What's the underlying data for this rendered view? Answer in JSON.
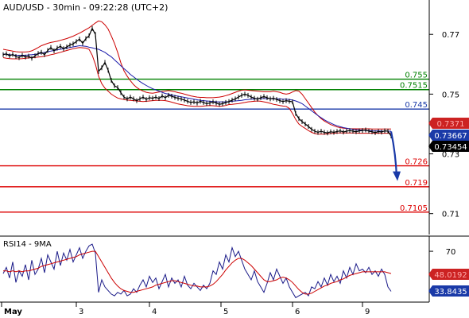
{
  "header": {
    "title": "AUD/USD - 30min - 09:22:28 (UTC+2)"
  },
  "colors": {
    "price": "#000000",
    "bollinger": "#cc0000",
    "moving_average": "#1a1aaa",
    "resistance": "#008000",
    "pivot": "#1a3aa8",
    "support": "#dd0000",
    "forecast_arrow": "#1a3aa8",
    "rsi_line": "#1a1a88",
    "rsi_ma": "#cc0000",
    "axis_text": "#000000"
  },
  "chart_data": [
    {
      "type": "line",
      "title": "AUD/USD - 30min - 09:22:28 (UTC+2)",
      "x_ticks": [
        "May",
        "3",
        "4",
        "5",
        "6",
        "9"
      ],
      "y_ticks": [
        "0.77",
        "0.75",
        "0.73",
        "0.71"
      ],
      "ylim": [
        0.703,
        0.7815
      ],
      "grid": false,
      "x": [
        0,
        4,
        8,
        12,
        16,
        20,
        24,
        28,
        32,
        36,
        40,
        44,
        48,
        52,
        56,
        60,
        64,
        68,
        72,
        76,
        80,
        84,
        88,
        92,
        96,
        100,
        104,
        108,
        112,
        116,
        120,
        124,
        128,
        132,
        136,
        140,
        144,
        148,
        152,
        156,
        160,
        164,
        168,
        172,
        176,
        180,
        184,
        188,
        192,
        196,
        200,
        204,
        208,
        212,
        216,
        220,
        224,
        228,
        232,
        236,
        240,
        244,
        248,
        252,
        256,
        260,
        264,
        268,
        272,
        276,
        280,
        284,
        288,
        292,
        296,
        300,
        304,
        308,
        312,
        316,
        320,
        324,
        328,
        332,
        336,
        340,
        344,
        348,
        352,
        356,
        360,
        364,
        368,
        372,
        376,
        380,
        384,
        388,
        392,
        396,
        400,
        404,
        408,
        412,
        416,
        420,
        424,
        428,
        432,
        436,
        440,
        444,
        448,
        452,
        456,
        460,
        464,
        468,
        472,
        476,
        480,
        484,
        488
      ],
      "series": [
        {
          "key": "price",
          "values": [
            0.7632,
            0.7635,
            0.7628,
            0.7633,
            0.7626,
            0.7622,
            0.763,
            0.7624,
            0.7627,
            0.762,
            0.7628,
            0.7636,
            0.764,
            0.7632,
            0.7646,
            0.7656,
            0.7645,
            0.7654,
            0.766,
            0.7652,
            0.7658,
            0.7664,
            0.7668,
            0.7676,
            0.7684,
            0.767,
            0.7686,
            0.7695,
            0.772,
            0.77,
            0.7576,
            0.7588,
            0.7606,
            0.758,
            0.7546,
            0.7528,
            0.7522,
            0.7505,
            0.749,
            0.7484,
            0.749,
            0.7484,
            0.7478,
            0.7484,
            0.749,
            0.7482,
            0.7488,
            0.7486,
            0.749,
            0.7485,
            0.7494,
            0.7488,
            0.7496,
            0.7493,
            0.7489,
            0.7486,
            0.7484,
            0.748,
            0.7476,
            0.7472,
            0.7474,
            0.747,
            0.7476,
            0.7472,
            0.7468,
            0.747,
            0.7474,
            0.747,
            0.7466,
            0.7468,
            0.7472,
            0.7475,
            0.748,
            0.7484,
            0.749,
            0.7496,
            0.75,
            0.7496,
            0.749,
            0.7486,
            0.7483,
            0.7488,
            0.7492,
            0.7488,
            0.7484,
            0.7486,
            0.7482,
            0.7478,
            0.7475,
            0.7478,
            0.7476,
            0.7474,
            0.7435,
            0.7418,
            0.7408,
            0.74,
            0.7392,
            0.7382,
            0.7376,
            0.7372,
            0.7376,
            0.7372,
            0.737,
            0.7374,
            0.7372,
            0.7375,
            0.7377,
            0.7373,
            0.7376,
            0.7378,
            0.7376,
            0.7374,
            0.7377,
            0.7378,
            0.738,
            0.7376,
            0.7374,
            0.7371,
            0.7375,
            0.7373,
            0.7377,
            0.7376,
            0.736
          ]
        },
        {
          "key": "ma",
          "values": [
            0.7634,
            0.7633,
            0.7632,
            0.7631,
            0.763,
            0.763,
            0.763,
            0.763,
            0.7631,
            0.7632,
            0.7633,
            0.7635,
            0.7637,
            0.764,
            0.7642,
            0.7644,
            0.7646,
            0.7648,
            0.765,
            0.7652,
            0.7654,
            0.7656,
            0.7658,
            0.766,
            0.7662,
            0.7661,
            0.766,
            0.7657,
            0.7655,
            0.7652,
            0.765,
            0.7645,
            0.764,
            0.7632,
            0.7625,
            0.7615,
            0.7605,
            0.7595,
            0.7585,
            0.7576,
            0.7566,
            0.7558,
            0.755,
            0.7542,
            0.7535,
            0.7529,
            0.7523,
            0.7518,
            0.7514,
            0.751,
            0.7506,
            0.7502,
            0.75,
            0.7497,
            0.7495,
            0.7493,
            0.7491,
            0.7489,
            0.7487,
            0.7485,
            0.7483,
            0.7481,
            0.7479,
            0.7478,
            0.7477,
            0.7476,
            0.7475,
            0.7474,
            0.7474,
            0.7474,
            0.7474,
            0.7475,
            0.7476,
            0.7477,
            0.7478,
            0.7479,
            0.7481,
            0.7482,
            0.7483,
            0.7484,
            0.7485,
            0.7485,
            0.7485,
            0.7485,
            0.7485,
            0.7484,
            0.7484,
            0.7484,
            0.7483,
            0.7483,
            0.7482,
            0.748,
            0.7477,
            0.7473,
            0.7468,
            0.746,
            0.7452,
            0.7444,
            0.7436,
            0.7428,
            0.7421,
            0.7414,
            0.7408,
            0.7403,
            0.7398,
            0.7394,
            0.7391,
            0.7388,
            0.7386,
            0.7384,
            0.7382,
            0.7381,
            0.738,
            0.7379,
            0.7378,
            0.7378,
            0.7377,
            0.7377,
            0.7377,
            0.7376,
            0.7376,
            0.7376,
            0.7376
          ]
        },
        {
          "key": "bb_upper",
          "values": [
            0.765,
            0.7648,
            0.7646,
            0.7644,
            0.7642,
            0.7641,
            0.7641,
            0.7641,
            0.7642,
            0.7645,
            0.765,
            0.7656,
            0.7662,
            0.7666,
            0.767,
            0.7673,
            0.7675,
            0.7677,
            0.768,
            0.7683,
            0.7686,
            0.769,
            0.7694,
            0.7699,
            0.7704,
            0.771,
            0.7716,
            0.7722,
            0.773,
            0.7738,
            0.7745,
            0.7742,
            0.7732,
            0.7718,
            0.7695,
            0.767,
            0.764,
            0.7605,
            0.7578,
            0.756,
            0.7545,
            0.7532,
            0.7522,
            0.7515,
            0.751,
            0.7506,
            0.7504,
            0.7503,
            0.7505,
            0.7507,
            0.7509,
            0.751,
            0.7512,
            0.751,
            0.7508,
            0.7505,
            0.7503,
            0.75,
            0.7497,
            0.7494,
            0.7492,
            0.749,
            0.7489,
            0.7489,
            0.7488,
            0.7488,
            0.7488,
            0.7489,
            0.749,
            0.7492,
            0.7495,
            0.7498,
            0.7502,
            0.7506,
            0.751,
            0.7513,
            0.7514,
            0.7513,
            0.7512,
            0.7511,
            0.751,
            0.7509,
            0.7508,
            0.7508,
            0.7508,
            0.751,
            0.7508,
            0.7506,
            0.7502,
            0.75,
            0.7502,
            0.7507,
            0.7512,
            0.751,
            0.75,
            0.7485,
            0.747,
            0.7455,
            0.744,
            0.7428,
            0.7418,
            0.741,
            0.7404,
            0.7398,
            0.7394,
            0.739,
            0.7388,
            0.7386,
            0.7385,
            0.7384,
            0.7384,
            0.7384,
            0.7384,
            0.7384,
            0.7384,
            0.7384,
            0.7383,
            0.7383,
            0.7383,
            0.7383,
            0.7383,
            0.7383,
            0.7383
          ]
        },
        {
          "key": "bb_lower",
          "values": [
            0.7622,
            0.762,
            0.7619,
            0.7618,
            0.7618,
            0.7618,
            0.7619,
            0.762,
            0.7621,
            0.7622,
            0.7623,
            0.7624,
            0.7625,
            0.7627,
            0.7629,
            0.7632,
            0.7634,
            0.7637,
            0.764,
            0.7643,
            0.7646,
            0.7649,
            0.7652,
            0.7654,
            0.7656,
            0.7655,
            0.7654,
            0.765,
            0.763,
            0.76,
            0.756,
            0.7535,
            0.752,
            0.751,
            0.75,
            0.7493,
            0.7487,
            0.7484,
            0.7482,
            0.748,
            0.7479,
            0.7478,
            0.7477,
            0.7476,
            0.7475,
            0.7476,
            0.7477,
            0.7478,
            0.7479,
            0.7479,
            0.7479,
            0.7478,
            0.7476,
            0.7473,
            0.747,
            0.7467,
            0.7465,
            0.7463,
            0.7461,
            0.746,
            0.7459,
            0.7459,
            0.7459,
            0.746,
            0.7461,
            0.7462,
            0.7461,
            0.746,
            0.7459,
            0.746,
            0.7462,
            0.7465,
            0.7466,
            0.7467,
            0.7468,
            0.747,
            0.7472,
            0.7474,
            0.7475,
            0.7476,
            0.7477,
            0.7476,
            0.7474,
            0.7472,
            0.7469,
            0.7466,
            0.7464,
            0.7462,
            0.746,
            0.7459,
            0.7452,
            0.7435,
            0.7415,
            0.74,
            0.7392,
            0.7385,
            0.7378,
            0.7372,
            0.7368,
            0.7366,
            0.7366,
            0.7366,
            0.7367,
            0.7368,
            0.7369,
            0.737,
            0.737,
            0.737,
            0.737,
            0.737,
            0.737,
            0.737,
            0.7369,
            0.7369,
            0.7369,
            0.7369,
            0.7369,
            0.7369,
            0.7369,
            0.7369,
            0.7369,
            0.7369,
            0.7369
          ]
        }
      ],
      "levels": [
        {
          "value": 0.755,
          "label": "0.755",
          "kind": "resistance"
        },
        {
          "value": 0.7515,
          "label": "0.7515",
          "kind": "resistance"
        },
        {
          "value": 0.745,
          "label": "0.745",
          "kind": "pivot"
        },
        {
          "value": 0.726,
          "label": "0.726",
          "kind": "support"
        },
        {
          "value": 0.719,
          "label": "0.719",
          "kind": "support"
        },
        {
          "value": 0.7105,
          "label": "0.7105",
          "kind": "support"
        }
      ],
      "price_tags": [
        {
          "value": 0.7371,
          "label": "0.7371",
          "bg": "#cc2222",
          "fg": "#ffaaaa"
        },
        {
          "value": 0.73667,
          "label": "0.73667",
          "bg": "#1a3aa8",
          "fg": "#ffffff"
        },
        {
          "value": 0.73454,
          "label": "0.73454",
          "bg": "#000000",
          "fg": "#ffffff"
        }
      ],
      "forecast_arrow": {
        "from": {
          "x": 488,
          "y": 0.7375
        },
        "to": {
          "x": 495,
          "y": 0.722
        }
      }
    },
    {
      "type": "line",
      "title": "RSI14 - 9MA",
      "y_ticks": [
        "70"
      ],
      "ylim": [
        13,
        87
      ],
      "x": [
        0,
        4,
        8,
        12,
        16,
        20,
        24,
        28,
        32,
        36,
        40,
        44,
        48,
        52,
        56,
        60,
        64,
        68,
        72,
        76,
        80,
        84,
        88,
        92,
        96,
        100,
        104,
        108,
        112,
        116,
        120,
        124,
        128,
        132,
        136,
        140,
        144,
        148,
        152,
        156,
        160,
        164,
        168,
        172,
        176,
        180,
        184,
        188,
        192,
        196,
        200,
        204,
        208,
        212,
        216,
        220,
        224,
        228,
        232,
        236,
        240,
        244,
        248,
        252,
        256,
        260,
        264,
        268,
        272,
        276,
        280,
        284,
        288,
        292,
        296,
        300,
        304,
        308,
        312,
        316,
        320,
        324,
        328,
        332,
        336,
        340,
        344,
        348,
        352,
        356,
        360,
        364,
        368,
        372,
        376,
        380,
        384,
        388,
        392,
        396,
        400,
        404,
        408,
        412,
        416,
        420,
        424,
        428,
        432,
        436,
        440,
        444,
        448,
        452,
        456,
        460,
        464,
        468,
        472,
        476,
        480,
        484,
        488
      ],
      "series": [
        {
          "key": "rsi",
          "values": [
            45,
            52,
            40,
            58,
            35,
            48,
            42,
            55,
            38,
            60,
            44,
            50,
            62,
            46,
            66,
            58,
            50,
            70,
            54,
            68,
            60,
            72,
            58,
            66,
            74,
            62,
            70,
            76,
            78,
            68,
            24,
            38,
            30,
            26,
            22,
            20,
            24,
            22,
            26,
            20,
            22,
            28,
            24,
            32,
            38,
            30,
            42,
            35,
            40,
            28,
            36,
            44,
            30,
            40,
            34,
            38,
            30,
            42,
            32,
            28,
            34,
            30,
            26,
            32,
            28,
            34,
            48,
            44,
            58,
            50,
            66,
            58,
            74,
            64,
            70,
            60,
            50,
            44,
            38,
            48,
            36,
            30,
            24,
            34,
            46,
            38,
            50,
            42,
            34,
            40,
            30,
            24,
            18,
            20,
            22,
            24,
            20,
            30,
            28,
            36,
            30,
            40,
            32,
            44,
            36,
            42,
            34,
            48,
            40,
            52,
            44,
            56,
            48,
            50,
            46,
            52,
            44,
            48,
            42,
            50,
            44,
            30,
            25
          ]
        },
        {
          "key": "rsi_ma",
          "values": [
            48,
            48,
            47,
            48,
            47,
            48,
            47,
            48,
            48,
            49,
            50,
            51,
            53,
            54,
            55,
            56,
            57,
            58,
            59,
            60,
            61,
            62,
            63,
            64,
            66,
            67,
            68,
            69,
            70,
            70,
            64,
            58,
            52,
            46,
            40,
            35,
            31,
            28,
            26,
            25,
            24,
            24,
            25,
            26,
            27,
            28,
            29,
            30,
            32,
            33,
            34,
            35,
            36,
            37,
            37,
            36,
            35,
            34,
            33,
            32,
            31,
            31,
            30,
            30,
            30,
            31,
            33,
            36,
            40,
            44,
            49,
            53,
            57,
            60,
            62,
            62,
            60,
            57,
            54,
            50,
            46,
            42,
            38,
            36,
            36,
            37,
            38,
            40,
            41,
            40,
            38,
            35,
            31,
            27,
            24,
            22,
            22,
            23,
            25,
            27,
            29,
            31,
            32,
            34,
            35,
            36,
            38,
            39,
            41,
            43,
            44,
            45,
            46,
            47,
            47,
            47,
            47,
            47,
            47,
            47,
            47,
            46,
            45
          ]
        }
      ],
      "price_tags": [
        {
          "value": 48.0192,
          "label": "48.0192",
          "bg": "#cc2222",
          "fg": "#ffaaaa"
        },
        {
          "value": 33.8435,
          "label": "33.8435",
          "bg": "#1a3aa8",
          "fg": "#ffffff"
        }
      ]
    }
  ]
}
